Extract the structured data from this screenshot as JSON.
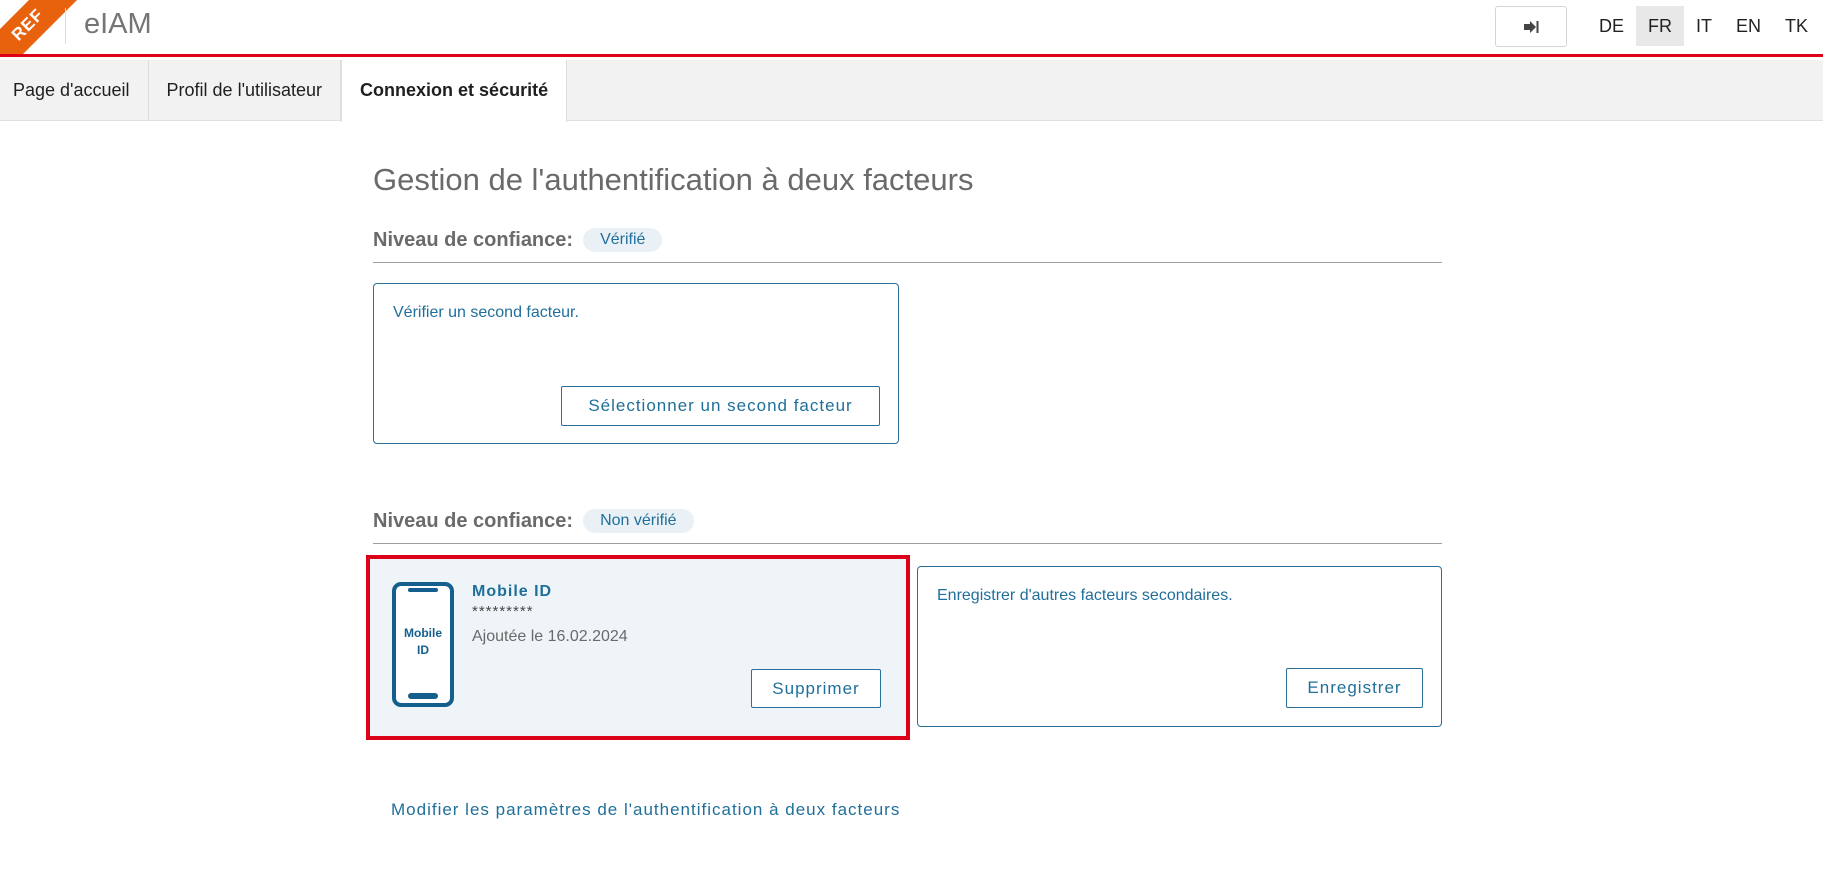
{
  "header": {
    "ribbon_text": "REF",
    "app_title": "eIAM",
    "logout_icon": "logout-icon",
    "languages": [
      "DE",
      "FR",
      "IT",
      "EN",
      "TK"
    ],
    "active_language": "FR"
  },
  "tabs": [
    {
      "label": "Page d'accueil",
      "active": false
    },
    {
      "label": "Profil de l'utilisateur",
      "active": false
    },
    {
      "label": "Connexion et sécurité",
      "active": true
    }
  ],
  "main": {
    "title": "Gestion de l'authentification à deux facteurs",
    "verified_section": {
      "label": "Niveau de confiance:",
      "badge": "Vérifié",
      "card_text": "Vérifier un second facteur.",
      "button": "Sélectionner un second facteur"
    },
    "unverified_section": {
      "label": "Niveau de confiance:",
      "badge": "Non vérifié",
      "mobile_card": {
        "icon": "mobile-phone-icon",
        "phone_label_line1": "Mobile",
        "phone_label_line2": "ID",
        "title": "Mobile ID",
        "masked_value": "*********",
        "added": "Ajoutée le 16.02.2024",
        "button": "Supprimer"
      },
      "register_card": {
        "text": "Enregistrer d'autres facteurs secondaires.",
        "button": "Enregistrer"
      }
    },
    "bottom_link": "Modifier les paramètres de l'authentification à deux facteurs"
  },
  "colors": {
    "accent_red": "#dc0018",
    "link_blue": "#1f6f9a",
    "ribbon_orange": "#e8620e"
  }
}
